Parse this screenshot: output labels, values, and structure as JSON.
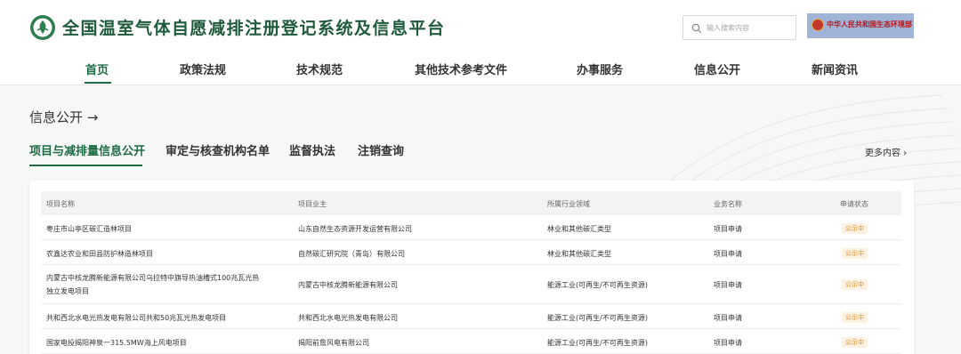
{
  "header": {
    "site_title": "全国温室气体自愿减排注册登记系统及信息平台",
    "search_placeholder": "输入搜索内容",
    "ministry_label": "中华人民共和国生态环境部"
  },
  "nav": {
    "items": [
      "首页",
      "政策法规",
      "技术规范",
      "其他技术参考文件",
      "办事服务",
      "信息公开",
      "新闻资讯"
    ],
    "active_index": 0
  },
  "section": {
    "title": "信息公开",
    "arrow": "→"
  },
  "subtabs": {
    "items": [
      "项目与减排量信息公开",
      "审定与核查机构名单",
      "监督执法",
      "注销查询"
    ],
    "active_index": 0
  },
  "more_link": "更多内容 ›",
  "table": {
    "headers": [
      "项目名称",
      "项目业主",
      "所属行业领域",
      "业务名称",
      "申请状态"
    ],
    "rows": [
      {
        "name": "枣庄市山亭区碳汇造林项目",
        "name2": "",
        "owner": "山东自然生态资源开发运营有限公司",
        "industry": "林业和其他碳汇类型",
        "business": "项目申请",
        "status": "公示中"
      },
      {
        "name": "农鑫达农业和田县防护林造林项目",
        "name2": "",
        "owner": "自然碳汇研究院（青岛）有限公司",
        "industry": "林业和其他碳汇类型",
        "business": "项目申请",
        "status": "公示中"
      },
      {
        "name": "内蒙古中核龙腾新能源有限公司乌拉特中旗导热油槽式100兆瓦光热",
        "name2": "独立发电项目",
        "owner": "内蒙古中核龙腾新能源有限公司",
        "industry": "能源工业(可再生/不可再生资源)",
        "business": "项目申请",
        "status": "公示中"
      },
      {
        "name": "共和西北水电光热发电有限公司共和50兆瓦光热发电项目",
        "name2": "",
        "owner": "共和西北水电光热发电有限公司",
        "industry": "能源工业(可再生/不可再生资源)",
        "business": "项目申请",
        "status": "公示中"
      },
      {
        "name": "国家电投揭阳神泉一315.5MW海上风电项目",
        "name2": "",
        "owner": "揭阳前詹风电有限公司",
        "industry": "能源工业(可再生/不可再生资源)",
        "business": "项目申请",
        "status": "公示中"
      }
    ]
  },
  "colors": {
    "brand_green": "#1f6b45",
    "status_orange": "#e28a1b"
  },
  "icons": {
    "logo": "ccer-logo-icon",
    "search": "search-icon",
    "ministry": "ministry-emblem-icon"
  }
}
